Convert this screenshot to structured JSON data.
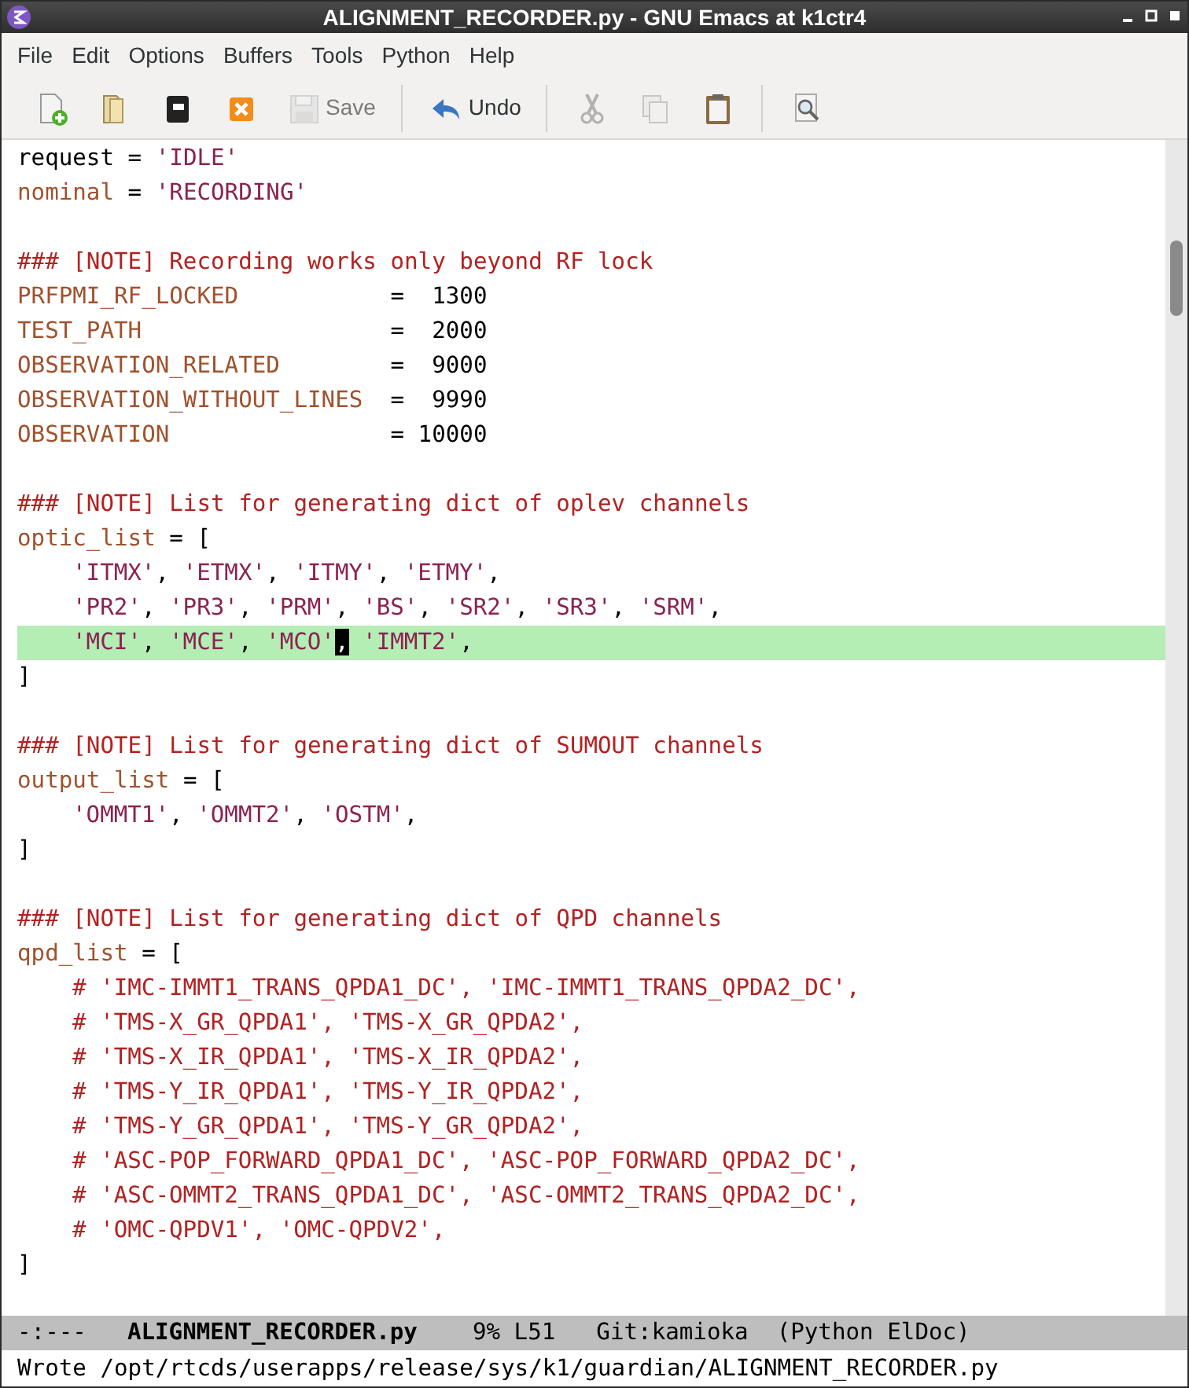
{
  "window": {
    "title": "ALIGNMENT_RECORDER.py - GNU Emacs at k1ctr4"
  },
  "menu": [
    "File",
    "Edit",
    "Options",
    "Buffers",
    "Tools",
    "Python",
    "Help"
  ],
  "toolbar": [
    {
      "kind": "new",
      "disabled": false
    },
    {
      "kind": "open",
      "disabled": false
    },
    {
      "kind": "dired",
      "disabled": false
    },
    {
      "kind": "close",
      "disabled": false
    },
    {
      "kind": "save",
      "label": "Save",
      "disabled": true
    },
    {
      "kind": "separator"
    },
    {
      "kind": "undo",
      "label": "Undo",
      "disabled": false
    },
    {
      "kind": "separator"
    },
    {
      "kind": "cut",
      "disabled": true
    },
    {
      "kind": "copy",
      "disabled": true
    },
    {
      "kind": "paste",
      "disabled": false
    },
    {
      "kind": "separator"
    },
    {
      "kind": "search",
      "disabled": false
    }
  ],
  "lines": [
    {
      "tokens": [
        {
          "text": "request",
          "kind": "plain"
        },
        {
          "text": " = ",
          "kind": "plain"
        },
        {
          "text": "'IDLE'",
          "kind": "str"
        }
      ],
      "selected": false
    },
    {
      "tokens": [
        {
          "text": "nominal",
          "kind": "var"
        },
        {
          "text": " = ",
          "kind": "plain"
        },
        {
          "text": "'RECORDING'",
          "kind": "str"
        }
      ],
      "selected": false
    },
    {
      "space_before": true,
      "tokens": [
        {
          "text": "### [NOTE] Recording works only beyond RF lock",
          "kind": "comment"
        }
      ],
      "selected": false
    },
    {
      "tokens": [
        {
          "text": "PRFPMI_RF_LOCKED",
          "kind": "var"
        },
        {
          "text": "           =  1300",
          "kind": "plain"
        }
      ],
      "selected": false
    },
    {
      "tokens": [
        {
          "text": "TEST_PATH",
          "kind": "var"
        },
        {
          "text": "                  =  2000",
          "kind": "plain"
        }
      ],
      "selected": false
    },
    {
      "tokens": [
        {
          "text": "OBSERVATION_RELATED",
          "kind": "var"
        },
        {
          "text": "        =  9000",
          "kind": "plain"
        }
      ],
      "selected": false
    },
    {
      "tokens": [
        {
          "text": "OBSERVATION_WITHOUT_LINES",
          "kind": "var"
        },
        {
          "text": "  =  9990",
          "kind": "plain"
        }
      ],
      "selected": false
    },
    {
      "tokens": [
        {
          "text": "OBSERVATION",
          "kind": "var"
        },
        {
          "text": "                = 10000",
          "kind": "plain"
        }
      ],
      "selected": false
    },
    {
      "space_before": true,
      "tokens": [
        {
          "text": "### [NOTE] List for generating dict of oplev channels",
          "kind": "comment"
        }
      ],
      "selected": false
    },
    {
      "tokens": [
        {
          "text": "optic_list",
          "kind": "var"
        },
        {
          "text": " = [",
          "kind": "plain"
        }
      ],
      "selected": false
    },
    {
      "indent": true,
      "tokens": [
        {
          "text": "'ITMX'",
          "kind": "str"
        },
        {
          "text": ", ",
          "kind": "plain"
        },
        {
          "text": "'ETMX'",
          "kind": "str"
        },
        {
          "text": ", ",
          "kind": "plain"
        },
        {
          "text": "'ITMY'",
          "kind": "str"
        },
        {
          "text": ", ",
          "kind": "plain"
        },
        {
          "text": "'ETMY'",
          "kind": "str"
        },
        {
          "text": ",",
          "kind": "plain"
        }
      ],
      "selected": false
    },
    {
      "indent": true,
      "tokens": [
        {
          "text": "'PR2'",
          "kind": "str"
        },
        {
          "text": ", ",
          "kind": "plain"
        },
        {
          "text": "'PR3'",
          "kind": "str"
        },
        {
          "text": ", ",
          "kind": "plain"
        },
        {
          "text": "'PRM'",
          "kind": "str"
        },
        {
          "text": ", ",
          "kind": "plain"
        },
        {
          "text": "'BS'",
          "kind": "str"
        },
        {
          "text": ", ",
          "kind": "plain"
        },
        {
          "text": "'SR2'",
          "kind": "str"
        },
        {
          "text": ", ",
          "kind": "plain"
        },
        {
          "text": "'SR3'",
          "kind": "str"
        },
        {
          "text": ", ",
          "kind": "plain"
        },
        {
          "text": "'SRM'",
          "kind": "str"
        },
        {
          "text": ",",
          "kind": "plain"
        }
      ],
      "selected": false
    },
    {
      "indent": true,
      "tokens": [
        {
          "text": "'MCI'",
          "kind": "str"
        },
        {
          "text": ", ",
          "kind": "plain"
        },
        {
          "text": "'MCE'",
          "kind": "str"
        },
        {
          "text": ", ",
          "kind": "plain"
        },
        {
          "text": "'MCO'",
          "kind": "str"
        },
        {
          "text": ",",
          "kind": "cursor"
        },
        {
          "text": " 'IMMT2'",
          "kind": "str"
        },
        {
          "text": ",",
          "kind": "plain"
        }
      ],
      "selected": true
    },
    {
      "tokens": [
        {
          "text": "]",
          "kind": "plain"
        }
      ],
      "selected": false
    },
    {
      "space_before": true,
      "tokens": [
        {
          "text": "### [NOTE] List for generating dict of SUMOUT channels",
          "kind": "comment"
        }
      ],
      "selected": false
    },
    {
      "tokens": [
        {
          "text": "output_list",
          "kind": "var"
        },
        {
          "text": " = [",
          "kind": "plain"
        }
      ],
      "selected": false
    },
    {
      "indent": true,
      "tokens": [
        {
          "text": "'OMMT1'",
          "kind": "str"
        },
        {
          "text": ", ",
          "kind": "plain"
        },
        {
          "text": "'OMMT2'",
          "kind": "str"
        },
        {
          "text": ", ",
          "kind": "plain"
        },
        {
          "text": "'OSTM'",
          "kind": "str"
        },
        {
          "text": ",",
          "kind": "plain"
        }
      ],
      "selected": false
    },
    {
      "tokens": [
        {
          "text": "]",
          "kind": "plain"
        }
      ],
      "selected": false
    },
    {
      "space_before": true,
      "tokens": [
        {
          "text": "### [NOTE] List for generating dict of QPD channels",
          "kind": "comment"
        }
      ],
      "selected": false
    },
    {
      "tokens": [
        {
          "text": "qpd_list",
          "kind": "var"
        },
        {
          "text": " = [",
          "kind": "plain"
        }
      ],
      "selected": false
    },
    {
      "indent": true,
      "tokens": [
        {
          "text": "# 'IMC-IMMT1_TRANS_QPDA1_DC', 'IMC-IMMT1_TRANS_QPDA2_DC',",
          "kind": "comment"
        }
      ],
      "selected": false
    },
    {
      "indent": true,
      "tokens": [
        {
          "text": "# 'TMS-X_GR_QPDA1', 'TMS-X_GR_QPDA2',",
          "kind": "comment"
        }
      ],
      "selected": false
    },
    {
      "indent": true,
      "tokens": [
        {
          "text": "# 'TMS-X_IR_QPDA1', 'TMS-X_IR_QPDA2',",
          "kind": "comment"
        }
      ],
      "selected": false
    },
    {
      "indent": true,
      "tokens": [
        {
          "text": "# 'TMS-Y_IR_QPDA1', 'TMS-Y_IR_QPDA2',",
          "kind": "comment"
        }
      ],
      "selected": false
    },
    {
      "indent": true,
      "tokens": [
        {
          "text": "# 'TMS-Y_GR_QPDA1', 'TMS-Y_GR_QPDA2',",
          "kind": "comment"
        }
      ],
      "selected": false
    },
    {
      "indent": true,
      "tokens": [
        {
          "text": "# 'ASC-POP_FORWARD_QPDA1_DC', 'ASC-POP_FORWARD_QPDA2_DC',",
          "kind": "comment"
        }
      ],
      "selected": false
    },
    {
      "indent": true,
      "tokens": [
        {
          "text": "# 'ASC-OMMT2_TRANS_QPDA1_DC', 'ASC-OMMT2_TRANS_QPDA2_DC',",
          "kind": "comment"
        }
      ],
      "selected": false
    },
    {
      "indent": true,
      "tokens": [
        {
          "text": "# 'OMC-QPDV1', 'OMC-QPDV2',",
          "kind": "comment"
        }
      ],
      "selected": false
    },
    {
      "tokens": [
        {
          "text": "]",
          "kind": "plain"
        }
      ],
      "selected": false
    }
  ],
  "mode_line": {
    "status": "-:---",
    "buffer": "ALIGNMENT_RECORDER.py",
    "position": "9% L51",
    "vc": "Git:kamioka",
    "modes": "(Python ElDoc)"
  },
  "echo_area": "Wrote /opt/rtcds/userapps/release/sys/k1/guardian/ALIGNMENT_RECORDER.py"
}
